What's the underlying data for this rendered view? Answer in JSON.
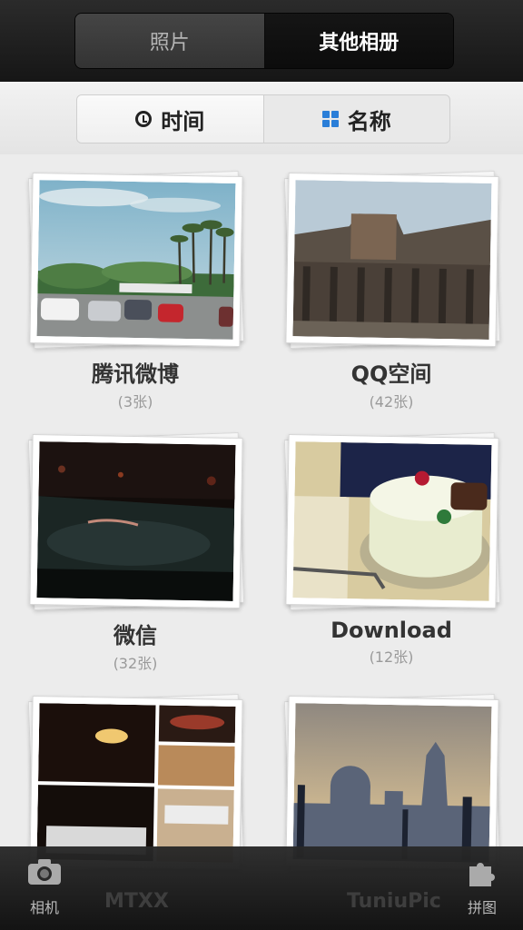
{
  "header": {
    "tabs": [
      {
        "label": "照片",
        "active": false
      },
      {
        "label": "其他相册",
        "active": true
      }
    ]
  },
  "sort": {
    "options": [
      {
        "label": "时间",
        "icon": "clock-icon",
        "active": true
      },
      {
        "label": "名称",
        "icon": "grid-icon",
        "active": false
      }
    ]
  },
  "albums": [
    {
      "name": "腾讯微博",
      "count": "(3张)"
    },
    {
      "name": "QQ空间",
      "count": "(42张)"
    },
    {
      "name": "微信",
      "count": "(32张)"
    },
    {
      "name": "Download",
      "count": "(12张)"
    },
    {
      "name": "MTXX",
      "count": ""
    },
    {
      "name": "TuniuPic",
      "count": ""
    }
  ],
  "bottom": {
    "camera_label": "相机",
    "puzzle_label": "拼图"
  },
  "colors": {
    "accent": "#2a7ed8",
    "topbar": "#1e1e1e",
    "background": "#ececec"
  }
}
